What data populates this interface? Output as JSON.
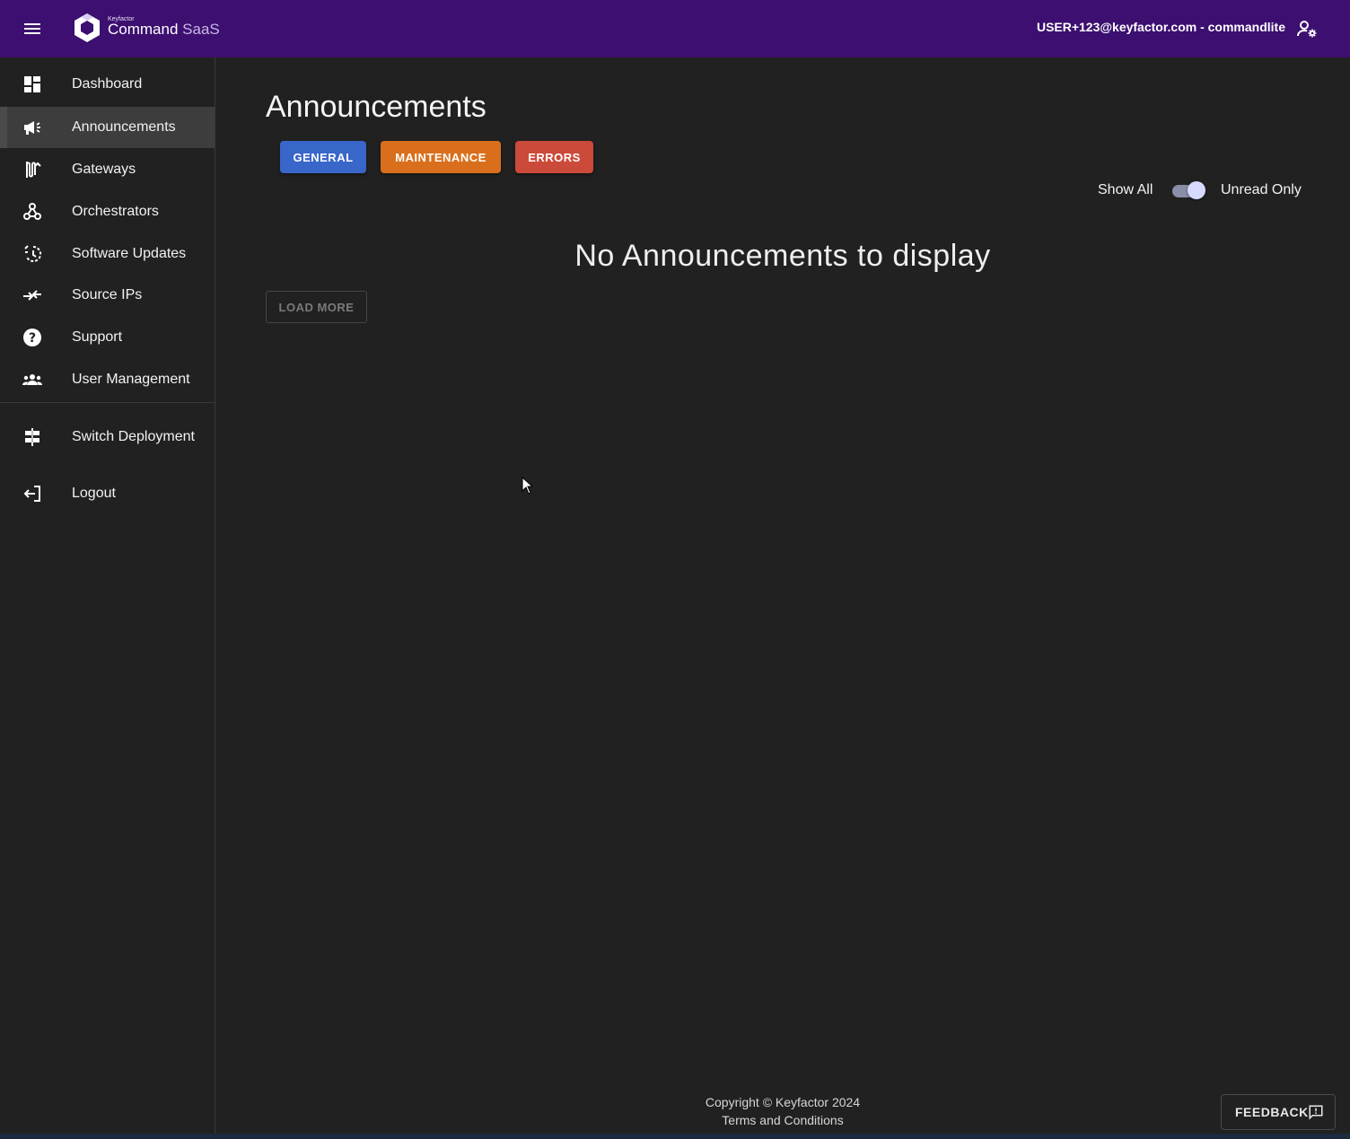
{
  "header": {
    "logo_small": "Keyfactor",
    "logo_main": "Command",
    "logo_suffix": "SaaS",
    "user": "USER+123@keyfactor.com - commandlite"
  },
  "sidebar": {
    "items": [
      {
        "label": "Dashboard",
        "icon": "dashboard-icon"
      },
      {
        "label": "Announcements",
        "icon": "megaphone-icon",
        "active": true
      },
      {
        "label": "Gateways",
        "icon": "gateway-icon"
      },
      {
        "label": "Orchestrators",
        "icon": "webhook-icon"
      },
      {
        "label": "Software Updates",
        "icon": "update-icon"
      },
      {
        "label": "Source IPs",
        "icon": "arrows-merge-icon"
      },
      {
        "label": "Support",
        "icon": "help-icon"
      },
      {
        "label": "User Management",
        "icon": "group-icon"
      },
      {
        "label": "Switch Deployment",
        "icon": "signpost-icon"
      },
      {
        "label": "Logout",
        "icon": "logout-icon"
      }
    ]
  },
  "main": {
    "title": "Announcements",
    "chips": {
      "general": "GENERAL",
      "maintenance": "MAINTENANCE",
      "errors": "ERRORS"
    },
    "toggle": {
      "left_label": "Show All",
      "right_label": "Unread Only",
      "state": "Unread Only"
    },
    "empty_message": "No Announcements to display",
    "load_more": "LOAD MORE"
  },
  "footer": {
    "copyright": "Copyright © Keyfactor 2024",
    "terms": "Terms and Conditions",
    "feedback": "FEEDBACK"
  },
  "colors": {
    "topbar": "#3c0f70",
    "background": "#212121",
    "general": "#3966c9",
    "maintenance": "#d96f1c",
    "errors": "#cc4a3a"
  }
}
